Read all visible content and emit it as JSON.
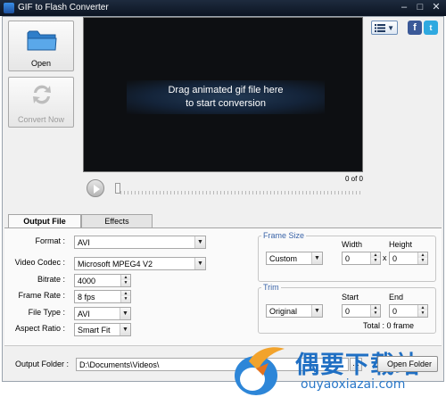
{
  "window": {
    "title": "GIF to Flash Converter",
    "controls": [
      "–",
      "□",
      "✕"
    ]
  },
  "toolbar": {
    "open_label": "Open",
    "convert_label": "Convert Now",
    "social": {
      "facebook": "f",
      "twitter": "t"
    }
  },
  "preview": {
    "message_line1": "Drag animated gif file here",
    "message_line2": "to start conversion",
    "frame_counter": "0 of 0"
  },
  "tabs": [
    {
      "label": "Output File",
      "active": true
    },
    {
      "label": "Effects",
      "active": false
    }
  ],
  "output_file": {
    "format": {
      "label": "Format :",
      "value": "AVI"
    },
    "video_codec": {
      "label": "Video Codec :",
      "value": "Microsoft MPEG4 V2"
    },
    "bitrate": {
      "label": "Bitrate :",
      "value": "4000"
    },
    "frame_rate": {
      "label": "Frame Rate :",
      "value": "8 fps"
    },
    "file_type": {
      "label": "File Type :",
      "value": "AVI"
    },
    "aspect_ratio": {
      "label": "Aspect Ratio :",
      "value": "Smart Fit"
    }
  },
  "frame_size": {
    "title": "Frame Size",
    "width_label": "Width",
    "height_label": "Height",
    "preset": "Custom",
    "width": "0",
    "height": "0",
    "separator": "x"
  },
  "trim": {
    "title": "Trim",
    "start_label": "Start",
    "end_label": "End",
    "mode": "Original",
    "start": "0",
    "end": "0",
    "total": "Total : 0 frame"
  },
  "output_folder": {
    "label": "Output Folder :",
    "path": "D:\\Documents\\Videos\\",
    "browse_label": "...",
    "open_folder_label": "Open Folder"
  },
  "watermark": {
    "chinese": "偶要下载站",
    "url": "ouyaoxiazai.com"
  },
  "colors": {
    "titlebar": "#0b1422",
    "accent": "#3a64a8",
    "facebook": "#3b5998",
    "twitter": "#2fa9e0",
    "watermark": "#1f6fc3"
  }
}
